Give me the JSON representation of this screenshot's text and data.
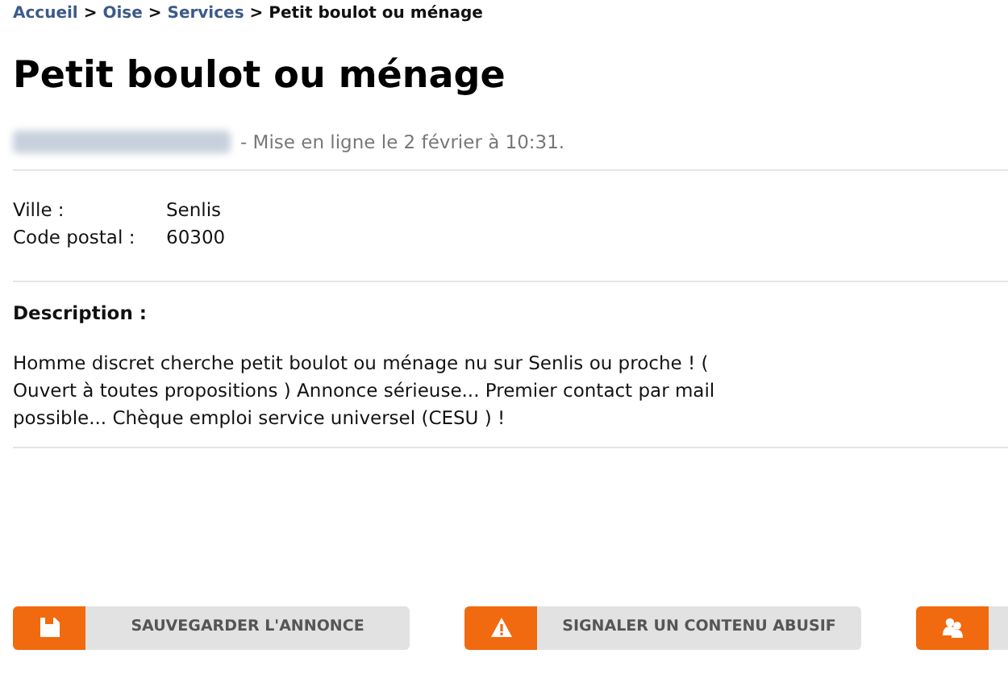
{
  "breadcrumb": [
    {
      "label": "Accueil",
      "link": true
    },
    {
      "label": "Oise",
      "link": true
    },
    {
      "label": "Services",
      "link": true
    },
    {
      "label": "Petit boulot ou ménage",
      "link": false
    }
  ],
  "separator": ">",
  "title": "Petit boulot ou ménage",
  "posted": "- Mise en ligne le 2 février à 10:31.",
  "fields": [
    {
      "label": "Ville :",
      "value": "Senlis"
    },
    {
      "label": "Code postal :",
      "value": "60300"
    }
  ],
  "description": {
    "heading": "Description :",
    "text": "Homme discret cherche petit boulot ou ménage nu sur Senlis ou proche ! ( Ouvert à toutes propositions ) Annonce sérieuse... Premier contact par mail possible... Chèque emploi service universel (CESU ) !"
  },
  "buttons": [
    {
      "kind": "save",
      "label": "SAUVEGARDER L'ANNONCE"
    },
    {
      "kind": "report",
      "label": "SIGNALER UN CONTENU ABUSIF"
    },
    {
      "kind": "people"
    }
  ]
}
